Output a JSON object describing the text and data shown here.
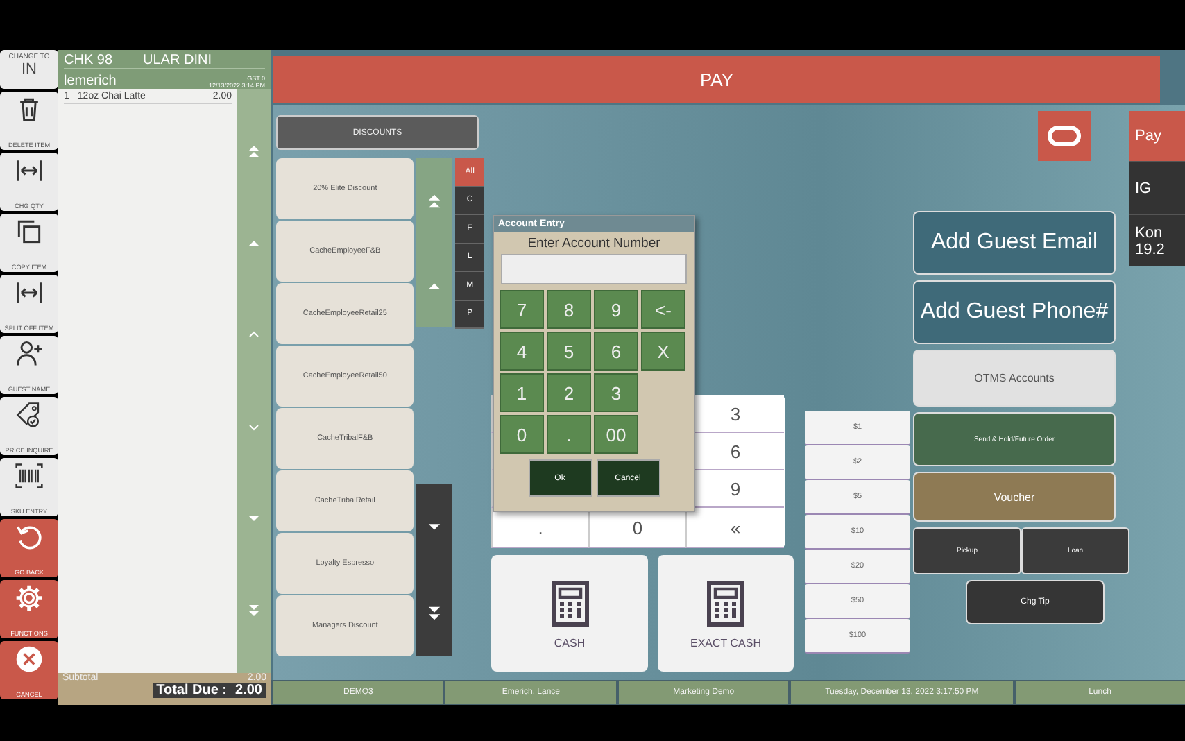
{
  "sidebar": {
    "mode_button": {
      "caption": "CHANGE TO",
      "value": "IN"
    },
    "items": [
      {
        "label": "DELETE ITEM",
        "kind": "normal"
      },
      {
        "label": "CHG QTY",
        "kind": "normal"
      },
      {
        "label": "COPY ITEM",
        "kind": "normal"
      },
      {
        "label": "SPLIT OFF ITEM",
        "kind": "normal"
      },
      {
        "label": "GUEST NAME",
        "kind": "normal"
      },
      {
        "label": "PRICE INQUIRE",
        "kind": "normal"
      },
      {
        "label": "SKU ENTRY",
        "kind": "normal"
      },
      {
        "label": "GO BACK",
        "kind": "alert"
      },
      {
        "label": "FUNCTIONS",
        "kind": "alert"
      },
      {
        "label": "CANCEL",
        "kind": "alert"
      }
    ]
  },
  "check": {
    "number": "CHK 98",
    "order_type": "ULAR DINI",
    "employee": "lemerich",
    "guests": "GST 0",
    "datetime": "12/13/2022 3:14 PM",
    "items": [
      {
        "qty": "1",
        "name": "12oz Chai Latte",
        "price": "2.00"
      }
    ],
    "subtotal_label": "Subtotal",
    "subtotal": "2.00",
    "total_label": "Total Due :",
    "total": "2.00"
  },
  "pay_bar": {
    "title": "PAY"
  },
  "discounts": {
    "title": "DISCOUNTS",
    "items": [
      "20% Elite Discount",
      "CacheEmployeeF&B",
      "CacheEmployeeRetail25",
      "CacheEmployeeRetail50",
      "CacheTribalF&B",
      "CacheTribalRetail",
      "Loyalty Espresso",
      "Managers Discount"
    ],
    "filters": [
      {
        "label": "All",
        "selected": true
      },
      {
        "label": "C",
        "selected": false
      },
      {
        "label": "E",
        "selected": false
      },
      {
        "label": "L",
        "selected": false
      },
      {
        "label": "M",
        "selected": false
      },
      {
        "label": "P",
        "selected": false
      }
    ]
  },
  "keypad": {
    "right_column": [
      "3",
      "6",
      "9",
      "«"
    ],
    "bottom_row": [
      ".",
      "0"
    ]
  },
  "tenders": [
    {
      "label": "CASH"
    },
    {
      "label": "EXACT CASH"
    }
  ],
  "amounts": [
    "$1",
    "$2",
    "$5",
    "$10",
    "$20",
    "$50",
    "$100"
  ],
  "actions": [
    {
      "label": "Add Guest Email",
      "kind": "large"
    },
    {
      "label": "Add Guest Phone#",
      "kind": "large"
    },
    {
      "label": "OTMS Accounts",
      "kind": "light"
    },
    {
      "label": "Send & Hold/Future Order",
      "kind": "green"
    },
    {
      "label": "Voucher",
      "kind": "gold"
    }
  ],
  "split_actions": [
    "Pickup",
    "Loan"
  ],
  "tip_button": "Chg Tip",
  "right_strip": [
    {
      "label": "Pay",
      "kind": "red"
    },
    {
      "label": "IG",
      "kind": "dark"
    },
    {
      "label": "Kon 19.2",
      "kind": "dark"
    }
  ],
  "dialog": {
    "title": "Account Entry",
    "prompt": "Enter Account Number",
    "keys": [
      "7",
      "8",
      "9",
      "<-",
      "4",
      "5",
      "6",
      "X",
      "1",
      "2",
      "3",
      "0",
      ".",
      "00"
    ],
    "buttons": [
      "Ok",
      "Cancel"
    ]
  },
  "status_bar": [
    "DEMO3",
    "Emerich, Lance",
    "Marketing Demo",
    "Tuesday, December 13, 2022 3:17:50 PM",
    "Lunch"
  ]
}
